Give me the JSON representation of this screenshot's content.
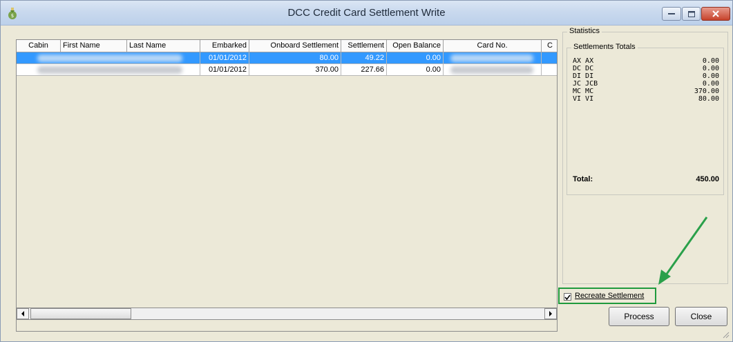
{
  "window": {
    "title": "DCC Credit Card Settlement Write",
    "icon": "money-bag-icon"
  },
  "grid": {
    "columns": [
      "Cabin",
      "First Name",
      "Last Name",
      "Embarked",
      "Onboard Settlement",
      "Settlement",
      "Open Balance",
      "Card No.",
      "C"
    ],
    "rows": [
      {
        "embarked": "01/01/2012",
        "onboard": "80.00",
        "settlement": "49.22",
        "open_balance": "0.00",
        "selected": true
      },
      {
        "embarked": "01/01/2012",
        "onboard": "370.00",
        "settlement": "227.66",
        "open_balance": "0.00",
        "selected": false
      }
    ]
  },
  "statistics": {
    "group_label": "Statistics",
    "totals_label": "Settlements Totals",
    "items": [
      {
        "label": "AX AX",
        "value": "0.00"
      },
      {
        "label": "DC DC",
        "value": "0.00"
      },
      {
        "label": "DI DI",
        "value": "0.00"
      },
      {
        "label": "JC JCB",
        "value": "0.00"
      },
      {
        "label": "MC MC",
        "value": "370.00"
      },
      {
        "label": "VI VI",
        "value": "80.00"
      }
    ],
    "total_label": "Total:",
    "total_value": "450.00"
  },
  "recreate": {
    "label": "Recreate Settlement",
    "checked": true
  },
  "buttons": {
    "process": "Process",
    "close": "Close"
  },
  "colors": {
    "selection": "#3399ff",
    "highlight_box": "#1f9a3c",
    "arrow": "#2aa04a"
  }
}
